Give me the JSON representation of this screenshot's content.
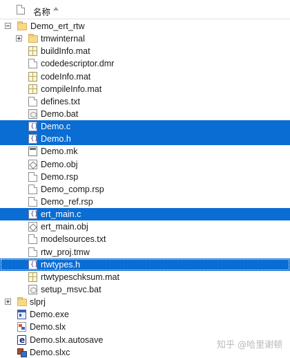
{
  "header": {
    "column_label": "名称"
  },
  "tree": {
    "root_folder": "Demo_ert_rtw",
    "items": [
      {
        "label": "tmwinternal",
        "type": "folder",
        "expandable": true
      },
      {
        "label": "buildInfo.mat",
        "type": "mat"
      },
      {
        "label": "codedescriptor.dmr",
        "type": "doc"
      },
      {
        "label": "codeInfo.mat",
        "type": "mat"
      },
      {
        "label": "compileInfo.mat",
        "type": "mat"
      },
      {
        "label": "defines.txt",
        "type": "doc"
      },
      {
        "label": "Demo.bat",
        "type": "bat"
      },
      {
        "label": "Demo.c",
        "type": "c",
        "selected": true
      },
      {
        "label": "Demo.h",
        "type": "c",
        "selected": true
      },
      {
        "label": "Demo.mk",
        "type": "mk"
      },
      {
        "label": "Demo.obj",
        "type": "obj"
      },
      {
        "label": "Demo.rsp",
        "type": "doc"
      },
      {
        "label": "Demo_comp.rsp",
        "type": "doc"
      },
      {
        "label": "Demo_ref.rsp",
        "type": "doc"
      },
      {
        "label": "ert_main.c",
        "type": "c",
        "selected": true
      },
      {
        "label": "ert_main.obj",
        "type": "obj"
      },
      {
        "label": "modelsources.txt",
        "type": "doc"
      },
      {
        "label": "rtw_proj.tmw",
        "type": "doc"
      },
      {
        "label": "rtwtypes.h",
        "type": "c",
        "selected": true,
        "focused": true
      },
      {
        "label": "rtwtypeschksum.mat",
        "type": "mat"
      },
      {
        "label": "setup_msvc.bat",
        "type": "bat"
      }
    ],
    "top_items": [
      {
        "label": "slprj",
        "type": "folder",
        "expandable": true
      },
      {
        "label": "Demo.exe",
        "type": "exe"
      },
      {
        "label": "Demo.slx",
        "type": "slx"
      },
      {
        "label": "Demo.slx.autosave",
        "type": "autosave"
      },
      {
        "label": "Demo.slxc",
        "type": "slxc"
      }
    ]
  },
  "watermark": {
    "text": "知乎 @哈里谢顿"
  },
  "colors": {
    "selection": "#0a6dd3",
    "folder": "#f7d98a"
  }
}
